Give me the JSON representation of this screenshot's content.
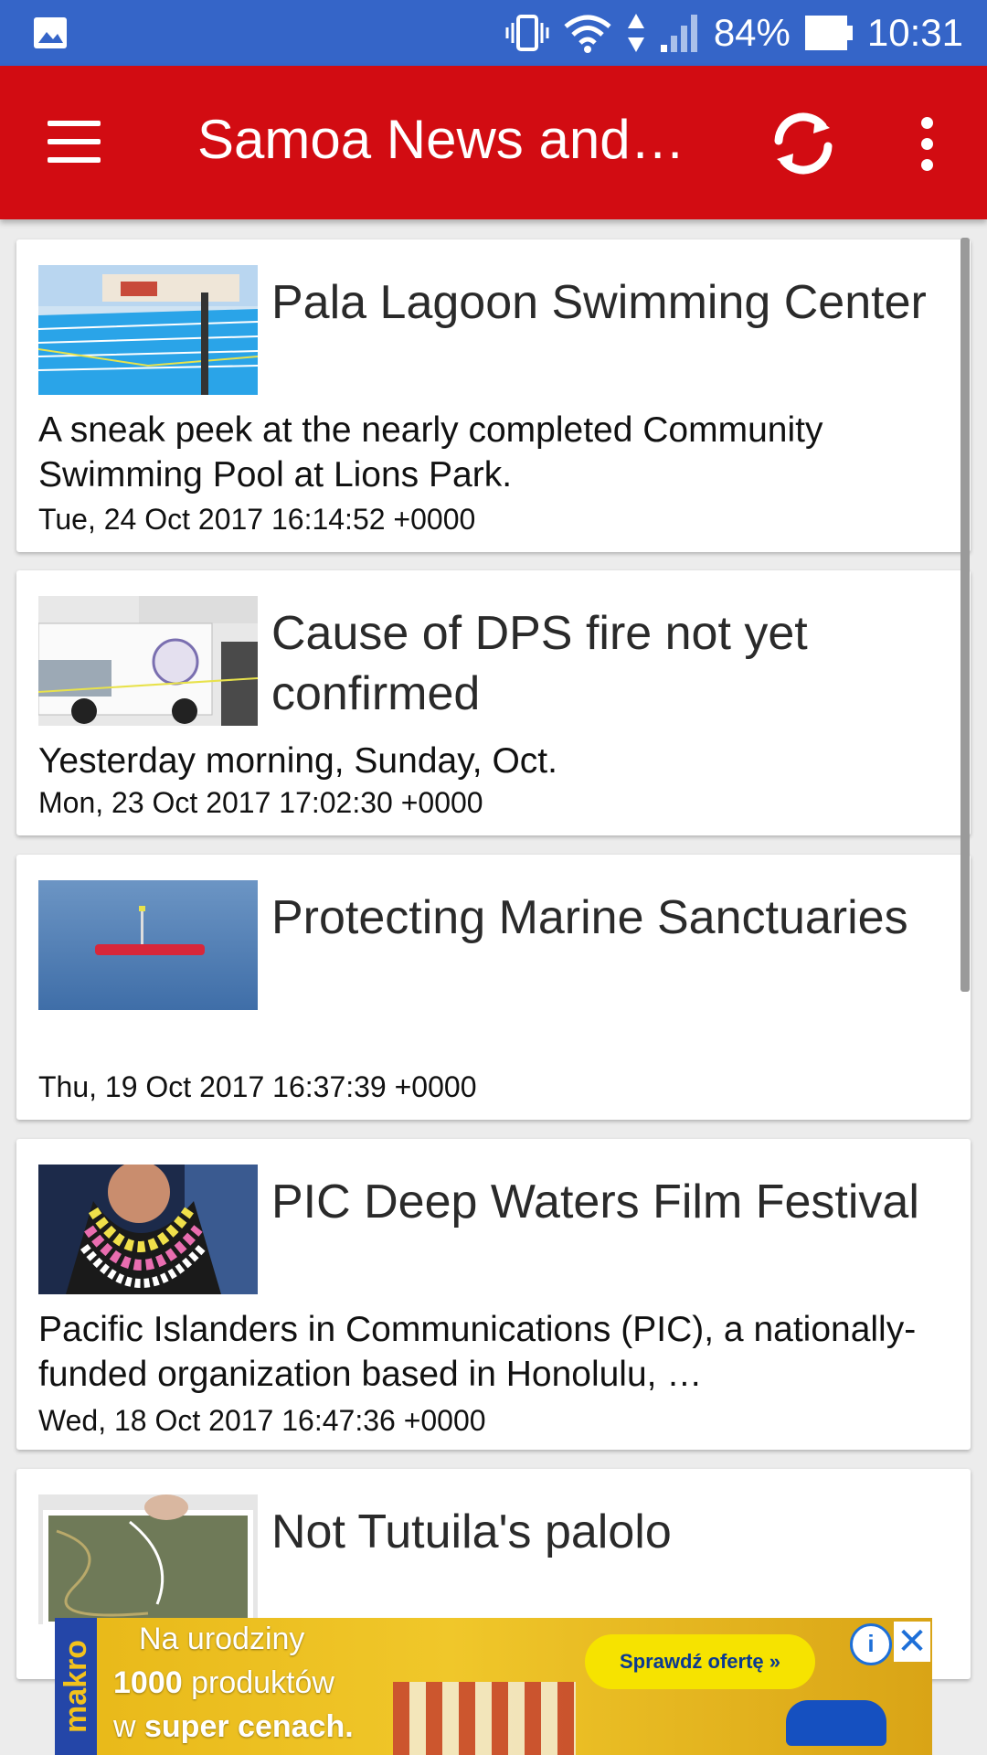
{
  "status_bar": {
    "battery": "84%",
    "time": "10:31",
    "icons": [
      "image-notification-icon",
      "vibrate-icon",
      "wifi-icon",
      "data-arrows-icon",
      "signal-icon",
      "battery-icon"
    ]
  },
  "app_bar": {
    "title": "Samoa News and…",
    "color": "#d20c12",
    "icons": [
      "menu-icon",
      "refresh-icon",
      "overflow-menu-icon"
    ]
  },
  "articles": [
    {
      "title": "Pala Lagoon Swimming Center",
      "description": "A sneak peek at the nearly completed Community Swimming Pool at Lions Park.",
      "date": "Tue, 24 Oct 2017 16:14:52 +0000"
    },
    {
      "title": "Cause of DPS fire not yet confirmed",
      "description": "Yesterday morning, Sunday, Oct.",
      "date": "Mon, 23 Oct 2017 17:02:30 +0000"
    },
    {
      "title": "Protecting Marine Sanctuaries",
      "description": "",
      "date": "Thu, 19 Oct 2017 16:37:39 +0000"
    },
    {
      "title": "PIC Deep Waters Film Festival",
      "description": "Pacific Islanders in Communications (PIC), a nationally-funded organization based in Honolulu, …",
      "date": "Wed, 18 Oct 2017 16:47:36 +0000"
    },
    {
      "title": "Not Tutuila's palolo",
      "description": "",
      "date": ""
    }
  ],
  "ad": {
    "brand": "makro",
    "line1": "Na urodziny",
    "line2_bold": "1000",
    "line2_rest": " produktów",
    "line3_pre": "w ",
    "line3_bold": "super cenach.",
    "cta": "Sprawdź ofertę »",
    "info_glyph": "i",
    "close_glyph": "✕"
  }
}
